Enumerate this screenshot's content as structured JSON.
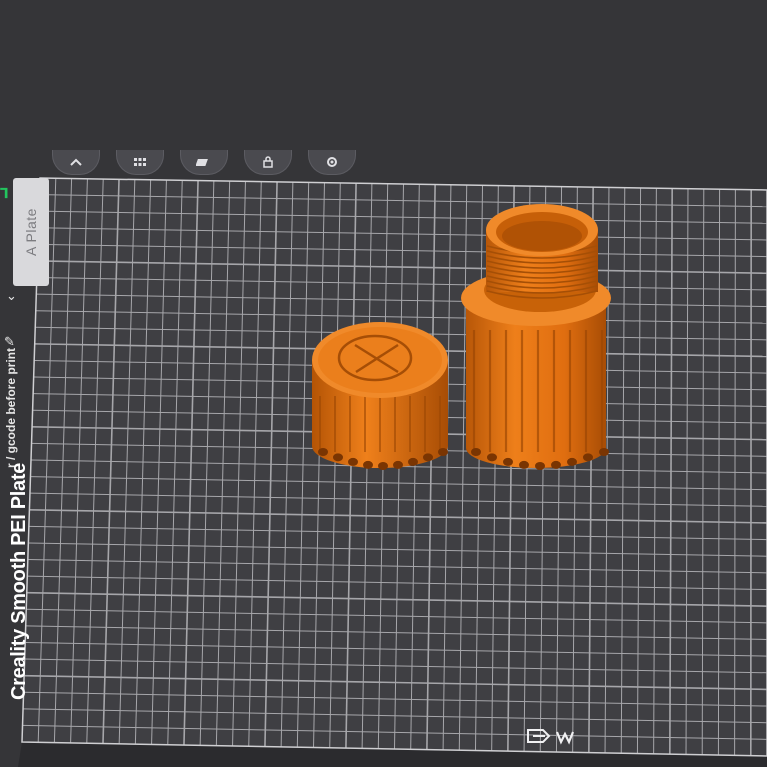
{
  "viewport": {
    "background": "#353538",
    "bed_color": "#3f3f43",
    "grid_color": "#b9b9bd",
    "model_color": "#e87513"
  },
  "toolbar": {
    "buttons": [
      {
        "icon": "chevron-icon"
      },
      {
        "icon": "grid-icon"
      },
      {
        "icon": "auto-arrange-icon"
      },
      {
        "icon": "lock-icon"
      },
      {
        "icon": "gear-icon"
      }
    ]
  },
  "plate": {
    "tab_label": "A Plate",
    "bed_name": "Creality Smooth PEI Plate",
    "gcode_hint": "r / gcode before print"
  },
  "models": [
    {
      "name": "cap",
      "icon": "cap-emblem-icon"
    },
    {
      "name": "threaded-container"
    }
  ]
}
